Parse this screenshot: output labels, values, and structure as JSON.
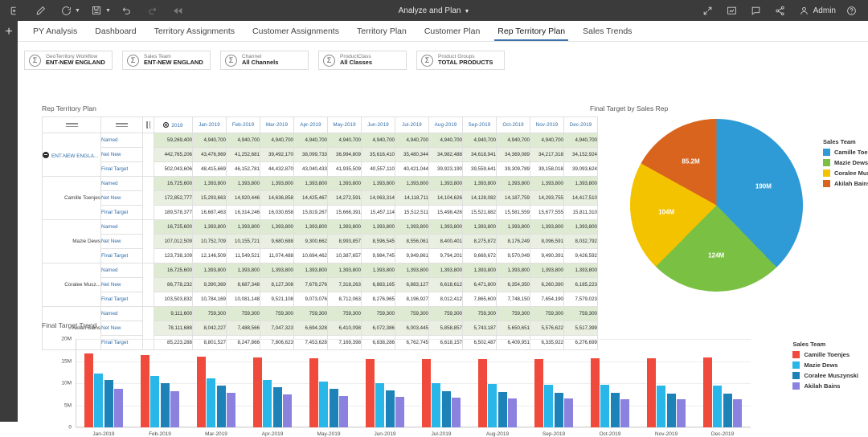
{
  "topbar": {
    "title": "Analyze and Plan",
    "admin_label": "Admin",
    "icons_left": [
      "login-icon",
      "edit-icon",
      "refresh-icon",
      "save-icon",
      "undo-icon",
      "redo-icon",
      "rewind-icon"
    ],
    "icons_right": [
      "expand-icon",
      "presentation-icon",
      "comment-icon",
      "share-icon",
      "user-icon",
      "help-icon"
    ]
  },
  "rail": {
    "add_label": "+"
  },
  "tabs": [
    {
      "label": "PY Analysis",
      "active": false
    },
    {
      "label": "Dashboard",
      "active": false
    },
    {
      "label": "Territory Assignments",
      "active": false
    },
    {
      "label": "Customer Assignments",
      "active": false
    },
    {
      "label": "Territory Plan",
      "active": false
    },
    {
      "label": "Customer Plan",
      "active": false
    },
    {
      "label": "Rep Territory Plan",
      "active": true
    },
    {
      "label": "Sales Trends",
      "active": false
    }
  ],
  "chips": [
    {
      "label": "GeoTerritory Workflow",
      "value": "ENT-NEW ENGLAND",
      "icon": "sigma-icon"
    },
    {
      "label": "Sales Team",
      "value": "ENT-NEW ENGLAND",
      "icon": "sigma-icon"
    },
    {
      "label": "Channel",
      "value": "All Channels",
      "icon": "sigma-icon"
    },
    {
      "label": "ProductClass",
      "value": "All Classes",
      "icon": "sigma-icon"
    },
    {
      "label": "Product Groups",
      "value": "TOTAL PRODUCTS",
      "icon": "sigma-icon"
    }
  ],
  "grid": {
    "title": "Rep Territory Plan",
    "columns": [
      "2019",
      "Jan-2019",
      "Feb-2019",
      "Mar-2019",
      "Apr-2019",
      "May-2019",
      "Jun-2019",
      "Jul-2019",
      "Aug-2019",
      "Sep-2019",
      "Oct-2019",
      "Nov-2019",
      "Dec-2019"
    ],
    "measures": [
      "Named",
      "Net New",
      "Final Target"
    ],
    "groups": [
      {
        "name": "ENT-NEW ENGLA...",
        "expanded": true,
        "rows": [
          {
            "measure": "Named",
            "values": [
              "59,269,400",
              "4,940,700",
              "4,940,700",
              "4,940,700",
              "4,940,700",
              "4,940,700",
              "4,940,700",
              "4,940,700",
              "4,940,700",
              "4,940,700",
              "4,940,700",
              "4,940,700",
              "4,940,700"
            ]
          },
          {
            "measure": "Net New",
            "values": [
              "442,765,206",
              "43,476,969",
              "41,252,681",
              "39,492,170",
              "38,099,733",
              "36,994,809",
              "35,616,410",
              "35,480,344",
              "34,982,488",
              "34,618,941",
              "34,369,089",
              "34,217,318",
              "34,152,924"
            ]
          },
          {
            "measure": "Final Target",
            "values": [
              "502,043,606",
              "48,415,669",
              "46,152,781",
              "44,432,870",
              "43,040,433",
              "41,935,509",
              "40,557,110",
              "40,421,044",
              "39,923,190",
              "39,559,641",
              "39,309,789",
              "39,158,018",
              "39,093,624"
            ]
          }
        ]
      },
      {
        "name": "Camille Toenjes",
        "expanded": false,
        "rows": [
          {
            "measure": "Named",
            "values": [
              "16,725,600",
              "1,393,800",
              "1,393,800",
              "1,393,800",
              "1,393,800",
              "1,393,800",
              "1,393,800",
              "1,393,800",
              "1,393,800",
              "1,393,800",
              "1,393,800",
              "1,393,800",
              "1,393,800"
            ]
          },
          {
            "measure": "Net New",
            "values": [
              "172,852,777",
              "15,293,663",
              "14,920,446",
              "14,636,858",
              "14,425,467",
              "14,272,591",
              "14,063,314",
              "14,118,711",
              "14,104,626",
              "14,128,082",
              "14,187,759",
              "14,293,755",
              "14,417,510"
            ]
          },
          {
            "measure": "Final Target",
            "values": [
              "189,578,377",
              "16,687,463",
              "16,314,246",
              "16,030,658",
              "15,819,267",
              "15,666,391",
              "15,457,114",
              "15,512,511",
              "15,498,426",
              "15,521,882",
              "15,581,559",
              "15,677,555",
              "15,811,310"
            ]
          }
        ]
      },
      {
        "name": "Mazie Dews",
        "expanded": false,
        "rows": [
          {
            "measure": "Named",
            "values": [
              "16,725,600",
              "1,393,800",
              "1,393,800",
              "1,393,800",
              "1,393,800",
              "1,393,800",
              "1,393,800",
              "1,393,800",
              "1,393,800",
              "1,393,800",
              "1,393,800",
              "1,393,800",
              "1,393,800"
            ]
          },
          {
            "measure": "Net New",
            "values": [
              "107,012,509",
              "10,752,709",
              "10,155,721",
              "9,680,688",
              "9,300,662",
              "8,993,857",
              "8,596,545",
              "8,556,061",
              "8,400,401",
              "8,275,872",
              "8,176,249",
              "8,096,591",
              "8,032,792"
            ]
          },
          {
            "measure": "Final Target",
            "values": [
              "123,738,109",
              "12,146,509",
              "11,549,521",
              "11,074,488",
              "10,694,462",
              "10,387,657",
              "9,984,745",
              "9,949,861",
              "9,794,201",
              "9,669,672",
              "9,570,049",
              "9,490,391",
              "9,426,592"
            ]
          }
        ]
      },
      {
        "name": "Coralee Musz...",
        "expanded": false,
        "rows": [
          {
            "measure": "Named",
            "values": [
              "16,725,600",
              "1,393,800",
              "1,393,800",
              "1,393,800",
              "1,393,800",
              "1,393,800",
              "1,393,800",
              "1,393,800",
              "1,393,800",
              "1,393,800",
              "1,393,800",
              "1,393,800",
              "1,393,800"
            ]
          },
          {
            "measure": "Net New",
            "values": [
              "86,778,232",
              "9,390,369",
              "8,687,348",
              "8,127,308",
              "7,679,276",
              "7,318,263",
              "6,883,165",
              "6,883,127",
              "6,618,612",
              "6,471,800",
              "6,354,350",
              "6,260,390",
              "6,185,223"
            ]
          },
          {
            "measure": "Final Target",
            "values": [
              "103,503,832",
              "10,784,169",
              "10,081,148",
              "9,521,108",
              "9,073,076",
              "8,712,063",
              "8,276,965",
              "8,196,927",
              "8,012,412",
              "7,865,600",
              "7,748,150",
              "7,654,190",
              "7,579,023"
            ]
          }
        ]
      },
      {
        "name": "Akilah Bains",
        "expanded": false,
        "rows": [
          {
            "measure": "Named",
            "values": [
              "9,111,600",
              "759,300",
              "759,300",
              "759,300",
              "759,300",
              "759,300",
              "759,300",
              "759,300",
              "759,300",
              "759,300",
              "759,300",
              "759,300",
              "759,300"
            ]
          },
          {
            "measure": "Net New",
            "values": [
              "78,111,688",
              "8,042,227",
              "7,488,566",
              "7,047,323",
              "6,694,328",
              "6,410,098",
              "6,072,386",
              "6,003,445",
              "5,858,857",
              "5,743,187",
              "5,650,651",
              "5,576,622",
              "5,517,399"
            ]
          },
          {
            "measure": "Final Target",
            "values": [
              "85,223,288",
              "8,801,527",
              "8,247,866",
              "7,806,623",
              "7,453,628",
              "7,169,398",
              "6,838,286",
              "6,762,745",
              "6,618,157",
              "6,502,487",
              "6,409,951",
              "6,335,922",
              "6,276,699"
            ]
          }
        ]
      }
    ]
  },
  "chart_data": [
    {
      "type": "pie",
      "title": "Final Target by Sales Rep",
      "legend_title": "Sales Team",
      "legend_position": "right",
      "categories": [
        "Camille Toenjes",
        "Mazie Dews",
        "Coralee Muszy...",
        "Akilah Bains"
      ],
      "values": [
        190,
        124,
        104,
        85.2
      ],
      "labels": [
        "190M",
        "124M",
        "104M",
        "85.2M"
      ],
      "colors": [
        "#2e9bd6",
        "#7ac143",
        "#f4c300",
        "#d9641e"
      ]
    },
    {
      "type": "bar",
      "title": "Final Target Trend",
      "legend_title": "Sales Team",
      "legend_position": "right",
      "xlabel": "",
      "ylabel": "",
      "ylim": [
        0,
        20000000
      ],
      "ytick_labels": [
        "0",
        "5M",
        "10M",
        "15M",
        "20M"
      ],
      "ytick_values": [
        0,
        5000000,
        10000000,
        15000000,
        20000000
      ],
      "grid": true,
      "categories": [
        "Jan-2019",
        "Feb-2019",
        "Mar-2019",
        "Apr-2019",
        "May-2019",
        "Jun-2019",
        "Jul-2019",
        "Aug-2019",
        "Sep-2019",
        "Oct-2019",
        "Nov-2019",
        "Dec-2019"
      ],
      "series": [
        {
          "name": "Camille Toenjes",
          "color": "#ef4a3c",
          "values": [
            16687463,
            16314246,
            16030658,
            15819267,
            15666391,
            15457114,
            15512511,
            15498426,
            15521882,
            15581559,
            15677555,
            15811310
          ]
        },
        {
          "name": "Mazie Dews",
          "color": "#29b6e8",
          "values": [
            12146509,
            11549521,
            11074488,
            10694462,
            10387657,
            9984745,
            9949861,
            9794201,
            9669672,
            9570049,
            9490391,
            9426592
          ]
        },
        {
          "name": "Coralee Muszynski",
          "color": "#1d82b8",
          "values": [
            10784169,
            10081148,
            9521108,
            9073076,
            8712063,
            8276965,
            8196927,
            8012412,
            7865600,
            7748150,
            7654190,
            7579023
          ]
        },
        {
          "name": "Akilah Bains",
          "color": "#8b82e0",
          "values": [
            8801527,
            8247866,
            7806623,
            7453628,
            7169398,
            6838286,
            6762745,
            6618157,
            6502487,
            6409951,
            6335922,
            6276699
          ]
        }
      ]
    }
  ]
}
